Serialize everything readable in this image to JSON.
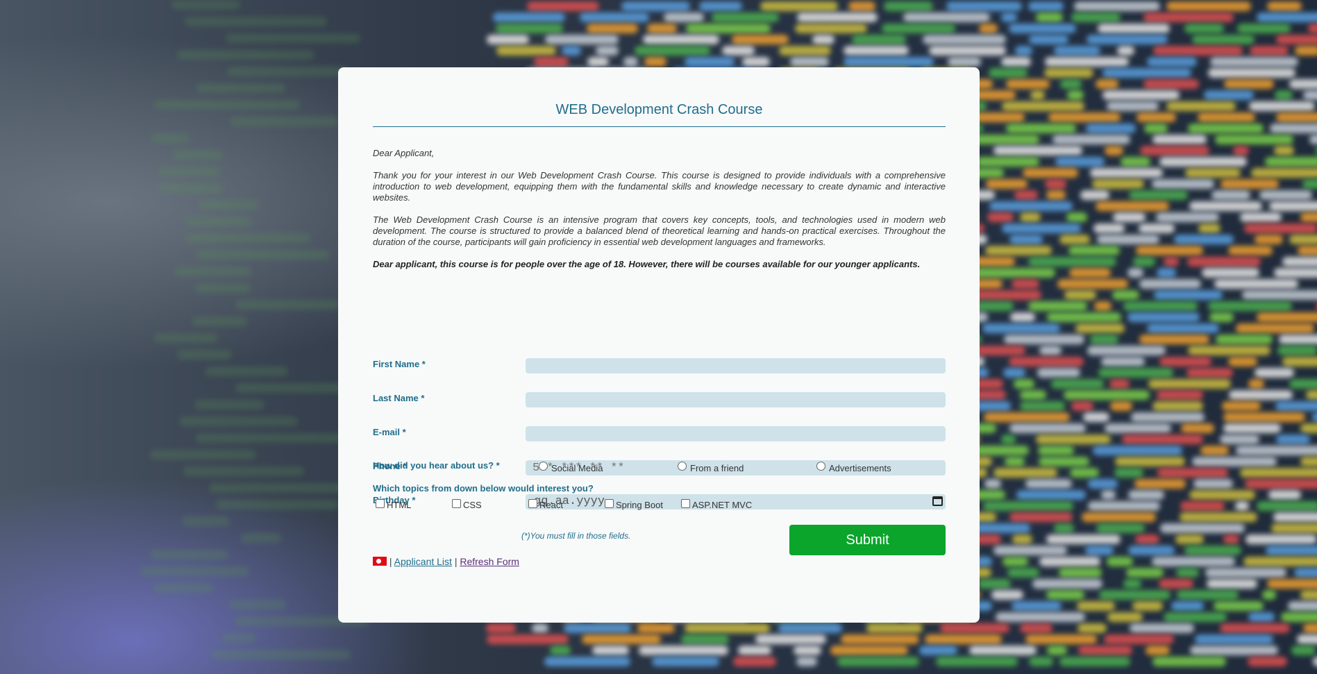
{
  "title": "WEB Development Crash Course",
  "letter": {
    "greeting": "Dear Applicant,",
    "para1": "Thank you for your interest in our Web Development Crash Course. This course is designed to provide individuals with a comprehensive introduction to web development, equipping them with the fundamental skills and knowledge necessary to create dynamic and interactive websites.",
    "para2": "The Web Development Crash Course is an intensive program that covers key concepts, tools, and technologies used in modern web development. The course is structured to provide a balanced blend of theoretical learning and hands-on practical exercises. Throughout the duration of the course, participants will gain proficiency in essential web development languages and frameworks.",
    "notice": "Dear applicant, this course is for people over the age of 18. However, there will be courses available for our younger applicants."
  },
  "fields": {
    "first_name": {
      "label": "First Name *",
      "value": "",
      "placeholder": ""
    },
    "last_name": {
      "label": "Last Name *",
      "value": "",
      "placeholder": ""
    },
    "email": {
      "label": "E-mail *",
      "value": "",
      "placeholder": ""
    },
    "phone": {
      "label": "Phone *",
      "value": "",
      "placeholder": "5** *** ** **"
    },
    "birthday": {
      "label": "Birthday *",
      "placeholder": "gg.aa.yyyy"
    }
  },
  "hear_about": {
    "label": "How did you hear about us? *",
    "options": [
      "Social Media",
      "From a friend",
      "Advertisements"
    ]
  },
  "topics": {
    "label": "Which topics from down below would interest you?",
    "options": [
      "HTML",
      "CSS",
      "React",
      "Spring Boot",
      "ASP.NET MVC"
    ]
  },
  "required_note": "(*)You must fill in those fields.",
  "submit_label": "Submit",
  "footer": {
    "separator": "|",
    "applicant_list": "Applicant List",
    "refresh_form": "Refresh Form"
  },
  "colors": {
    "accent": "#1f6e8c",
    "submit": "#0aa52a",
    "input_bg": "#cfe2ea"
  }
}
